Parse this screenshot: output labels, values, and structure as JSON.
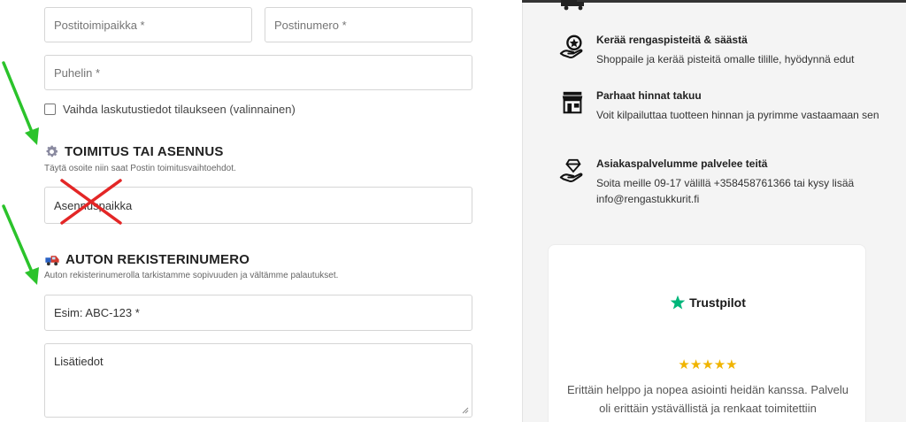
{
  "form": {
    "city_placeholder": "Postitoimipaikka *",
    "postcode_placeholder": "Postinumero *",
    "phone_placeholder": "Puhelin *",
    "billing_checkbox_label": "Vaihda laskutustiedot tilaukseen (valinnainen)",
    "delivery_section": {
      "icon": "gear-icon",
      "title": "TOIMITUS TAI ASENNUS",
      "description": "Täytä osoite niin saat Postin toimitusvaihtoehdot.",
      "field_placeholder": "Asennuspaikka"
    },
    "plate_section": {
      "icon": "car-icon",
      "title": "AUTON REKISTERINUMERO",
      "description": "Auton rekisterinumerolla tarkistamme sopivuuden ja vältämme palautukset.",
      "plate_placeholder": "Esim: ABC-123 *",
      "notes_placeholder": "Lisätiedot"
    }
  },
  "annotations": {
    "arrow_color": "#2bc32b",
    "cross_color": "#e32626"
  },
  "sidebar": {
    "features": [
      {
        "icon": "hand-star-icon",
        "title": "Kerää rengaspisteitä & säästä",
        "description": "Shoppaile ja kerää pisteitä omalle tilille, hyödynnä edut"
      },
      {
        "icon": "shop-icon",
        "title": "Parhaat hinnat takuu",
        "description": "Voit kilpailuttaa tuotteen hinnan ja pyrimme vastaamaan sen"
      },
      {
        "icon": "hand-diamond-icon",
        "title": "Asiakaspalvelumme palvelee teitä",
        "description": "Soita meille 09-17 välillä +358458761366 tai kysy lisää info@rengastukkurit.fi"
      }
    ],
    "review_card": {
      "brand": "Trustpilot",
      "brand_color": "#00b67a",
      "stars": "★★★★★",
      "rating": 5,
      "review_text": "Erittäin helppo ja nopea asiointi heidän kanssa. Palvelu oli erittäin ystävällistä ja renkaat toimitettiin"
    }
  }
}
